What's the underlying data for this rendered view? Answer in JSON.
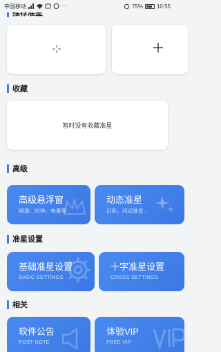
{
  "status_bar": {
    "carrier": "中国移动",
    "battery": "75%",
    "time": "10:55"
  },
  "sections": {
    "recommended": "推荐准星",
    "favorites": "收藏",
    "advanced": "高级",
    "crosshair_settings": "准星设置",
    "related": "相关"
  },
  "favorites": {
    "empty_text": "暂时没有收藏准星"
  },
  "advanced_cards": [
    {
      "title": "高级悬浮窗",
      "subtitle": "网速、时钟、电量等"
    },
    {
      "title": "动态准星",
      "subtitle": "幻彩、闪动准星..."
    }
  ],
  "crosshair_cards": [
    {
      "title": "基础准星设置",
      "subtitle": "BASIC SETTINGS"
    },
    {
      "title": "十字准星设置",
      "subtitle": "CROSS SETTINGS"
    }
  ],
  "related_cards": [
    {
      "title": "软件公告",
      "subtitle": "POST NOTE"
    },
    {
      "title": "体验VIP",
      "subtitle": "FREE VIP"
    }
  ],
  "icons": {
    "crosshair": "crosshair-icon",
    "add": "plus-icon"
  },
  "colors": {
    "accent": "#3f7fe8",
    "card_blue": "#4a8af0",
    "background": "#f3f4f6"
  }
}
